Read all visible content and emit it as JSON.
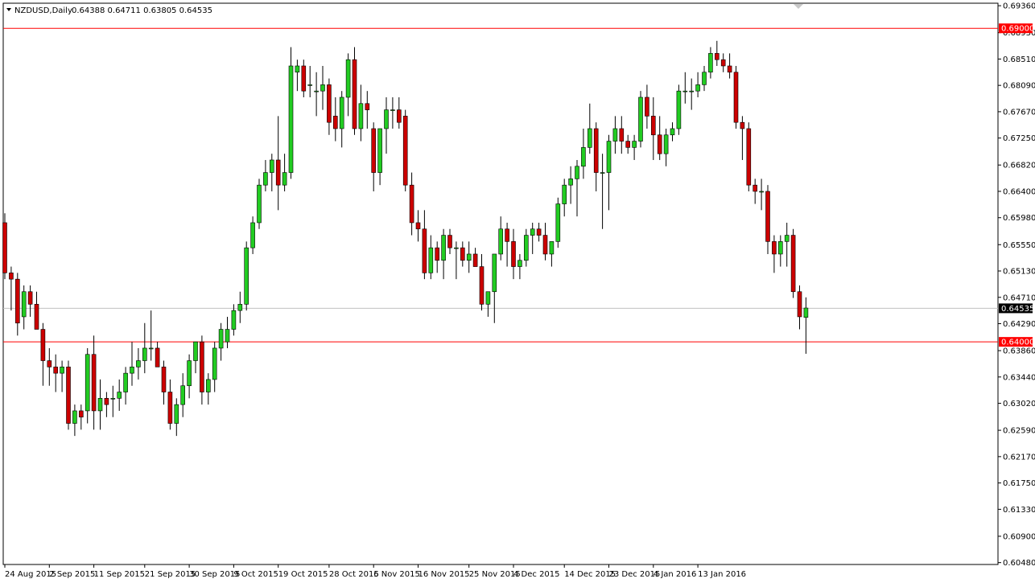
{
  "header": {
    "symbol": "NZDUSD,Daily",
    "ohlc": "0.64388 0.64711 0.63805 0.64535"
  },
  "colors": {
    "bull": "#22cc22",
    "bear": "#cc0000",
    "wick": "#000000",
    "level_line": "#ff0000",
    "current_line": "#c0c0c0",
    "frame": "#000000",
    "badge_level_bg": "#ff0000",
    "badge_current_bg": "#000000"
  },
  "chart_data": {
    "type": "candlestick",
    "title": "NZDUSD,Daily",
    "ylim": [
      0.6045,
      0.694
    ],
    "y_ticks": [
      "0.69360",
      "0.68930",
      "0.68510",
      "0.68090",
      "0.67670",
      "0.67250",
      "0.66820",
      "0.66400",
      "0.65980",
      "0.65550",
      "0.65130",
      "0.64710",
      "0.64290",
      "0.63860",
      "0.63440",
      "0.63020",
      "0.62590",
      "0.62170",
      "0.61750",
      "0.61330",
      "0.60900",
      "0.60480"
    ],
    "x_labels": [
      {
        "label": "24 Aug 2015",
        "index": 0
      },
      {
        "label": "2 Sep 2015",
        "index": 7
      },
      {
        "label": "11 Sep 2015",
        "index": 14
      },
      {
        "label": "21 Sep 2015",
        "index": 22
      },
      {
        "label": "30 Sep 2015",
        "index": 29
      },
      {
        "label": "9 Oct 2015",
        "index": 36
      },
      {
        "label": "19 Oct 2015",
        "index": 43
      },
      {
        "label": "28 Oct 2015",
        "index": 51
      },
      {
        "label": "6 Nov 2015",
        "index": 58
      },
      {
        "label": "16 Nov 2015",
        "index": 65
      },
      {
        "label": "25 Nov 2015",
        "index": 73
      },
      {
        "label": "4 Dec 2015",
        "index": 80
      },
      {
        "label": "14 Dec 2015",
        "index": 88
      },
      {
        "label": "23 Dec 2015",
        "index": 95
      },
      {
        "label": "4 Jan 2016",
        "index": 102
      },
      {
        "label": "13 Jan 2016",
        "index": 109
      }
    ],
    "levels": [
      {
        "value": 0.69,
        "label": "0.69000"
      },
      {
        "value": 0.64,
        "label": "0.64000"
      }
    ],
    "current": {
      "value": 0.64535,
      "label": "0.64535"
    },
    "candles": [
      [
        0.659,
        0.6605,
        0.65,
        0.651
      ],
      [
        0.651,
        0.652,
        0.645,
        0.65
      ],
      [
        0.65,
        0.651,
        0.641,
        0.643
      ],
      [
        0.644,
        0.649,
        0.642,
        0.648
      ],
      [
        0.648,
        0.649,
        0.644,
        0.646
      ],
      [
        0.646,
        0.648,
        0.642,
        0.642
      ],
      [
        0.642,
        0.643,
        0.633,
        0.637
      ],
      [
        0.637,
        0.639,
        0.633,
        0.636
      ],
      [
        0.636,
        0.638,
        0.632,
        0.635
      ],
      [
        0.635,
        0.637,
        0.632,
        0.636
      ],
      [
        0.636,
        0.637,
        0.626,
        0.627
      ],
      [
        0.627,
        0.63,
        0.625,
        0.629
      ],
      [
        0.629,
        0.63,
        0.626,
        0.628
      ],
      [
        0.629,
        0.639,
        0.627,
        0.638
      ],
      [
        0.638,
        0.641,
        0.626,
        0.629
      ],
      [
        0.629,
        0.634,
        0.626,
        0.631
      ],
      [
        0.631,
        0.632,
        0.628,
        0.63
      ],
      [
        0.631,
        0.633,
        0.628,
        0.631
      ],
      [
        0.631,
        0.634,
        0.629,
        0.632
      ],
      [
        0.632,
        0.636,
        0.63,
        0.635
      ],
      [
        0.635,
        0.64,
        0.633,
        0.636
      ],
      [
        0.636,
        0.639,
        0.634,
        0.637
      ],
      [
        0.637,
        0.643,
        0.635,
        0.639
      ],
      [
        0.639,
        0.645,
        0.637,
        0.639
      ],
      [
        0.639,
        0.64,
        0.636,
        0.636
      ],
      [
        0.636,
        0.637,
        0.63,
        0.632
      ],
      [
        0.632,
        0.634,
        0.626,
        0.627
      ],
      [
        0.627,
        0.631,
        0.625,
        0.63
      ],
      [
        0.63,
        0.635,
        0.628,
        0.633
      ],
      [
        0.633,
        0.638,
        0.631,
        0.637
      ],
      [
        0.637,
        0.64,
        0.635,
        0.64
      ],
      [
        0.64,
        0.641,
        0.63,
        0.632
      ],
      [
        0.632,
        0.635,
        0.63,
        0.634
      ],
      [
        0.634,
        0.64,
        0.632,
        0.639
      ],
      [
        0.639,
        0.643,
        0.637,
        0.642
      ],
      [
        0.64,
        0.644,
        0.639,
        0.642
      ],
      [
        0.642,
        0.646,
        0.641,
        0.645
      ],
      [
        0.645,
        0.648,
        0.643,
        0.646
      ],
      [
        0.646,
        0.656,
        0.645,
        0.655
      ],
      [
        0.655,
        0.66,
        0.654,
        0.659
      ],
      [
        0.659,
        0.666,
        0.658,
        0.665
      ],
      [
        0.665,
        0.669,
        0.664,
        0.667
      ],
      [
        0.667,
        0.67,
        0.664,
        0.669
      ],
      [
        0.669,
        0.676,
        0.661,
        0.665
      ],
      [
        0.665,
        0.67,
        0.664,
        0.667
      ],
      [
        0.667,
        0.687,
        0.666,
        0.684
      ],
      [
        0.683,
        0.685,
        0.68,
        0.684
      ],
      [
        0.684,
        0.685,
        0.679,
        0.68
      ],
      [
        0.681,
        0.684,
        0.679,
        0.681
      ],
      [
        0.68,
        0.683,
        0.676,
        0.68
      ],
      [
        0.68,
        0.684,
        0.677,
        0.681
      ],
      [
        0.681,
        0.682,
        0.673,
        0.675
      ],
      [
        0.676,
        0.679,
        0.672,
        0.674
      ],
      [
        0.674,
        0.68,
        0.671,
        0.679
      ],
      [
        0.679,
        0.686,
        0.676,
        0.685
      ],
      [
        0.685,
        0.687,
        0.673,
        0.674
      ],
      [
        0.674,
        0.681,
        0.672,
        0.678
      ],
      [
        0.678,
        0.68,
        0.674,
        0.677
      ],
      [
        0.674,
        0.675,
        0.664,
        0.667
      ],
      [
        0.667,
        0.674,
        0.665,
        0.674
      ],
      [
        0.674,
        0.679,
        0.67,
        0.677
      ],
      [
        0.677,
        0.679,
        0.674,
        0.677
      ],
      [
        0.677,
        0.679,
        0.674,
        0.675
      ],
      [
        0.676,
        0.677,
        0.664,
        0.665
      ],
      [
        0.665,
        0.667,
        0.657,
        0.659
      ],
      [
        0.659,
        0.661,
        0.656,
        0.658
      ],
      [
        0.658,
        0.661,
        0.65,
        0.651
      ],
      [
        0.651,
        0.657,
        0.65,
        0.655
      ],
      [
        0.655,
        0.656,
        0.651,
        0.653
      ],
      [
        0.653,
        0.658,
        0.65,
        0.657
      ],
      [
        0.657,
        0.658,
        0.654,
        0.655
      ],
      [
        0.655,
        0.656,
        0.65,
        0.655
      ],
      [
        0.655,
        0.656,
        0.652,
        0.653
      ],
      [
        0.653,
        0.656,
        0.651,
        0.654
      ],
      [
        0.654,
        0.655,
        0.652,
        0.652
      ],
      [
        0.652,
        0.654,
        0.645,
        0.646
      ],
      [
        0.646,
        0.648,
        0.644,
        0.648
      ],
      [
        0.648,
        0.654,
        0.643,
        0.654
      ],
      [
        0.654,
        0.66,
        0.653,
        0.658
      ],
      [
        0.658,
        0.659,
        0.652,
        0.656
      ],
      [
        0.656,
        0.658,
        0.65,
        0.652
      ],
      [
        0.652,
        0.654,
        0.65,
        0.653
      ],
      [
        0.653,
        0.658,
        0.652,
        0.657
      ],
      [
        0.657,
        0.659,
        0.654,
        0.658
      ],
      [
        0.658,
        0.659,
        0.656,
        0.657
      ],
      [
        0.657,
        0.659,
        0.653,
        0.654
      ],
      [
        0.654,
        0.656,
        0.652,
        0.656
      ],
      [
        0.656,
        0.663,
        0.655,
        0.662
      ],
      [
        0.662,
        0.666,
        0.66,
        0.665
      ],
      [
        0.665,
        0.668,
        0.662,
        0.666
      ],
      [
        0.666,
        0.669,
        0.66,
        0.668
      ],
      [
        0.668,
        0.674,
        0.666,
        0.671
      ],
      [
        0.671,
        0.678,
        0.67,
        0.674
      ],
      [
        0.674,
        0.675,
        0.664,
        0.667
      ],
      [
        0.667,
        0.67,
        0.658,
        0.667
      ],
      [
        0.667,
        0.673,
        0.661,
        0.672
      ],
      [
        0.672,
        0.676,
        0.67,
        0.674
      ],
      [
        0.674,
        0.676,
        0.67,
        0.672
      ],
      [
        0.672,
        0.673,
        0.67,
        0.671
      ],
      [
        0.671,
        0.673,
        0.669,
        0.672
      ],
      [
        0.672,
        0.68,
        0.671,
        0.679
      ],
      [
        0.679,
        0.681,
        0.674,
        0.676
      ],
      [
        0.676,
        0.679,
        0.669,
        0.673
      ],
      [
        0.673,
        0.676,
        0.669,
        0.67
      ],
      [
        0.67,
        0.674,
        0.668,
        0.673
      ],
      [
        0.673,
        0.675,
        0.672,
        0.674
      ],
      [
        0.674,
        0.681,
        0.673,
        0.68
      ],
      [
        0.68,
        0.683,
        0.678,
        0.68
      ],
      [
        0.68,
        0.682,
        0.677,
        0.68
      ],
      [
        0.68,
        0.683,
        0.679,
        0.681
      ],
      [
        0.681,
        0.684,
        0.68,
        0.683
      ],
      [
        0.683,
        0.687,
        0.682,
        0.686
      ],
      [
        0.686,
        0.688,
        0.684,
        0.685
      ],
      [
        0.685,
        0.686,
        0.683,
        0.684
      ],
      [
        0.684,
        0.686,
        0.682,
        0.683
      ],
      [
        0.683,
        0.684,
        0.674,
        0.675
      ],
      [
        0.675,
        0.676,
        0.669,
        0.674
      ],
      [
        0.674,
        0.675,
        0.664,
        0.665
      ],
      [
        0.665,
        0.666,
        0.662,
        0.664
      ],
      [
        0.664,
        0.666,
        0.661,
        0.664
      ],
      [
        0.664,
        0.665,
        0.654,
        0.656
      ],
      [
        0.656,
        0.657,
        0.651,
        0.654
      ],
      [
        0.654,
        0.657,
        0.652,
        0.656
      ],
      [
        0.656,
        0.659,
        0.652,
        0.657
      ],
      [
        0.657,
        0.658,
        0.647,
        0.648
      ],
      [
        0.648,
        0.649,
        0.642,
        0.644
      ],
      [
        0.6439,
        0.6471,
        0.6381,
        0.6454
      ]
    ]
  }
}
